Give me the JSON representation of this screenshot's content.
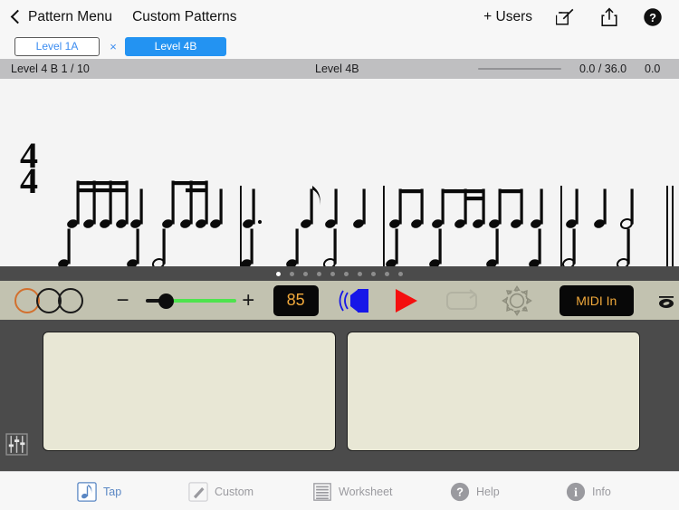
{
  "navbar": {
    "back_label": "Pattern Menu",
    "title": "Custom Patterns",
    "users_label": "+ Users",
    "icons": [
      "compose-icon",
      "share-icon",
      "help-circle-icon"
    ]
  },
  "tabs": {
    "inactive_label": "Level 1A",
    "close_label": "×",
    "active_label": "Level 4B"
  },
  "statusbar": {
    "left": "Level 4 B 1 / 10",
    "center": "Level 4B",
    "time": "0.0 / 36.0",
    "score": "0.0"
  },
  "score": {
    "time_signature_top": "4",
    "time_signature_bottom": "4"
  },
  "pager": {
    "count": 10,
    "active_index": 0
  },
  "transport": {
    "circles": [
      "orange",
      "black",
      "black"
    ],
    "minus_label": "−",
    "plus_label": "+",
    "tempo_value": "85",
    "midi_label": "MIDI In",
    "icons": [
      "speaker-icon",
      "play-icon",
      "loop-icon",
      "gear-icon",
      "whole-note-icon"
    ],
    "accent_colors": {
      "circle_orange": "#d2702e",
      "speaker": "#1616e8",
      "play": "#f40f0f",
      "slider_fill": "#4ee34e",
      "lcd_text": "#f1a93b",
      "lcd_bg": "#080808"
    }
  },
  "workarea": {
    "pads": [
      "tap-pad-left",
      "tap-pad-right"
    ],
    "mixer_icon": "mixer-sliders-icon",
    "pad_color": "#e8e7d5"
  },
  "tabbar": {
    "items": [
      {
        "label": "Tap",
        "icon": "eighth-note-icon",
        "active": true
      },
      {
        "label": "Custom",
        "icon": "pencil-icon",
        "active": false
      },
      {
        "label": "Worksheet",
        "icon": "lines-icon",
        "active": false
      },
      {
        "label": "Help",
        "icon": "question-circle-icon",
        "active": false
      },
      {
        "label": "Info",
        "icon": "info-circle-icon",
        "active": false
      }
    ]
  }
}
